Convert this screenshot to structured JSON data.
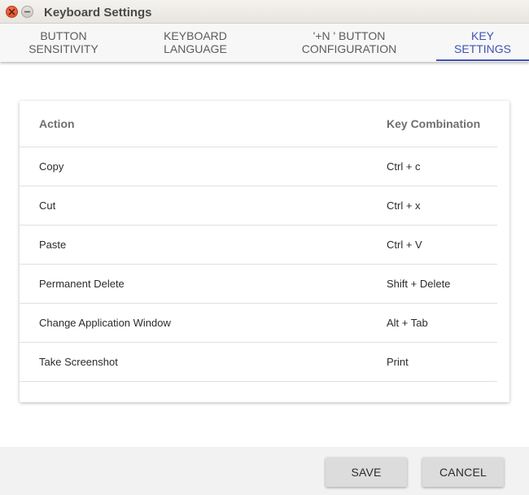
{
  "window": {
    "title": "Keyboard Settings",
    "close_icon": "close-icon",
    "minimize_icon": "minimize-icon"
  },
  "tabs": [
    {
      "line1": "BUTTON",
      "line2": "SENSITIVITY",
      "active": false
    },
    {
      "line1": "KEYBOARD",
      "line2": "LANGUAGE",
      "active": false
    },
    {
      "line1": "'+N ' BUTTON",
      "line2": "CONFIGURATION",
      "active": false
    },
    {
      "line1": "KEY",
      "line2": "SETTINGS",
      "active": true
    }
  ],
  "table": {
    "headers": {
      "action": "Action",
      "combo": "Key Combination"
    },
    "rows": [
      {
        "action": "Copy",
        "combo": "Ctrl + c"
      },
      {
        "action": "Cut",
        "combo": "Ctrl + x"
      },
      {
        "action": "Paste",
        "combo": "Ctrl + V"
      },
      {
        "action": "Permanent Delete",
        "combo": "Shift + Delete"
      },
      {
        "action": "Change Application Window",
        "combo": "Alt + Tab"
      },
      {
        "action": "Take Screenshot",
        "combo": "Print"
      }
    ]
  },
  "footer": {
    "save_label": "SAVE",
    "cancel_label": "CANCEL"
  },
  "colors": {
    "accent": "#3f51b5",
    "close_button": "#e0552f"
  }
}
